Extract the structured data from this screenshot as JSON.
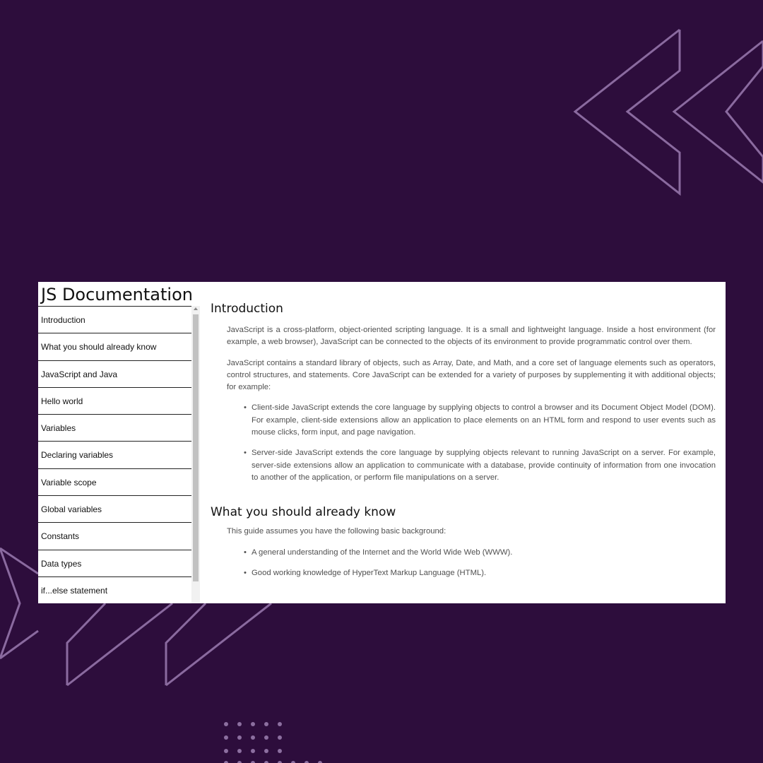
{
  "colors": {
    "background": "#2d0d3c",
    "accent_lines": "#8a6a9f",
    "panel": "#ffffff"
  },
  "sidebar": {
    "title": "JS Documentation",
    "items": [
      "Introduction",
      "What you should already know",
      "JavaScript and Java",
      "Hello world",
      "Variables",
      "Declaring variables",
      "Variable scope",
      "Global variables",
      "Constants",
      "Data types",
      "if...else statement"
    ]
  },
  "main": {
    "sections": [
      {
        "title": "Introduction",
        "paragraphs": [
          "JavaScript is a cross-platform, object-oriented scripting language. It is a small and lightweight language. Inside a host environment (for example, a web browser), JavaScript can be connected to the objects of its environment to provide programmatic control over them.",
          "JavaScript contains a standard library of objects, such as Array, Date, and Math, and a core set of language elements such as operators, control structures, and statements. Core JavaScript can be extended for a variety of purposes by supplementing it with additional objects; for example:"
        ],
        "bullets": [
          "Client-side JavaScript extends the core language by supplying objects to control a browser and its Document Object Model (DOM). For example, client-side extensions allow an application to place elements on an HTML form and respond to user events such as mouse clicks, form input, and page navigation.",
          "Server-side JavaScript extends the core language by supplying objects relevant to running JavaScript on a server. For example, server-side extensions allow an application to communicate with a database, provide continuity of information from one invocation to another of the application, or perform file manipulations on a server."
        ]
      },
      {
        "title": "What you should already know",
        "paragraphs": [
          "This guide assumes you have the following basic background:"
        ],
        "bullets": [
          "A general understanding of the Internet and the World Wide Web (WWW).",
          "Good working knowledge of HyperText Markup Language (HTML)."
        ]
      }
    ]
  }
}
